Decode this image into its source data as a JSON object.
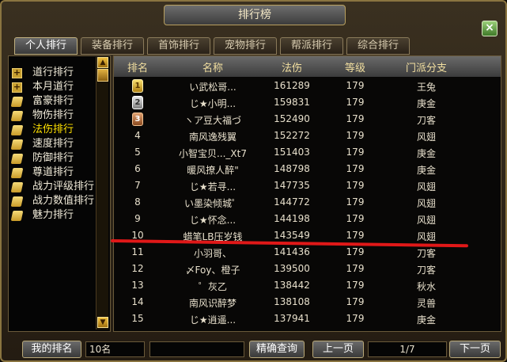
{
  "title": "排行榜",
  "tabs": [
    {
      "label": "个人排行",
      "active": true
    },
    {
      "label": "装备排行"
    },
    {
      "label": "首饰排行"
    },
    {
      "label": "宠物排行"
    },
    {
      "label": "帮派排行"
    },
    {
      "label": "综合排行"
    }
  ],
  "categories": [
    {
      "label": "道行排行",
      "icon": "plus-icon"
    },
    {
      "label": "本月道行",
      "icon": "plus-icon"
    },
    {
      "label": "富豪排行",
      "icon": "scroll-icon"
    },
    {
      "label": "物伤排行",
      "icon": "scroll-icon"
    },
    {
      "label": "法伤排行",
      "icon": "scroll-icon",
      "selected": true
    },
    {
      "label": "速度排行",
      "icon": "scroll-icon"
    },
    {
      "label": "防御排行",
      "icon": "scroll-icon"
    },
    {
      "label": "尊道排行",
      "icon": "scroll-icon"
    },
    {
      "label": "战力评级排行",
      "icon": "scroll-icon"
    },
    {
      "label": "战力数值排行",
      "icon": "scroll-icon"
    },
    {
      "label": "魅力排行",
      "icon": "scroll-icon"
    }
  ],
  "table": {
    "headers": [
      "排名",
      "名称",
      "法伤",
      "等级",
      "门派分支"
    ],
    "rows": [
      {
        "rank": "1",
        "medal": "gold",
        "name": "い武松哥...",
        "value": "161289",
        "level": "179",
        "branch": "王兔"
      },
      {
        "rank": "2",
        "medal": "silver",
        "name": "じ★小明...",
        "value": "159831",
        "level": "179",
        "branch": "庚金"
      },
      {
        "rank": "3",
        "medal": "bronze",
        "name": "ヽア豆大福づ",
        "value": "152490",
        "level": "179",
        "branch": "刀客"
      },
      {
        "rank": "4",
        "name": "南风逸残翼",
        "value": "152272",
        "level": "179",
        "branch": "风翅"
      },
      {
        "rank": "5",
        "name": "小智宝贝..._Xt7",
        "value": "151403",
        "level": "179",
        "branch": "庚金"
      },
      {
        "rank": "6",
        "name": "暖风撩人醉\"",
        "value": "148798",
        "level": "179",
        "branch": "庚金"
      },
      {
        "rank": "7",
        "name": "じ★若寻...",
        "value": "147735",
        "level": "179",
        "branch": "风翅"
      },
      {
        "rank": "8",
        "name": "い墨染倾城゜",
        "value": "144772",
        "level": "179",
        "branch": "风翅"
      },
      {
        "rank": "9",
        "name": "じ★怀念...",
        "value": "144198",
        "level": "179",
        "branch": "风翅"
      },
      {
        "rank": "10",
        "name": "蜡笔LB压岁钱",
        "value": "143549",
        "level": "179",
        "branch": "风翅"
      },
      {
        "rank": "11",
        "name": "小羽哥、",
        "value": "141436",
        "level": "179",
        "branch": "刀客"
      },
      {
        "rank": "12",
        "name": "〆Foy、橙子",
        "value": "139500",
        "level": "179",
        "branch": "刀客"
      },
      {
        "rank": "13",
        "name": "゜灰乙",
        "value": "138442",
        "level": "179",
        "branch": "秋水"
      },
      {
        "rank": "14",
        "name": "南风识醉梦",
        "value": "138108",
        "level": "179",
        "branch": "灵兽"
      },
      {
        "rank": "15",
        "name": "じ★逍遥...",
        "value": "137941",
        "level": "179",
        "branch": "庚金"
      }
    ]
  },
  "bottom": {
    "my_rank_label": "我的排名",
    "my_rank_value": "10名",
    "search_value": "",
    "search_button": "精确查询",
    "prev_button": "上一页",
    "page_indicator": "1/7",
    "next_button": "下一页"
  }
}
